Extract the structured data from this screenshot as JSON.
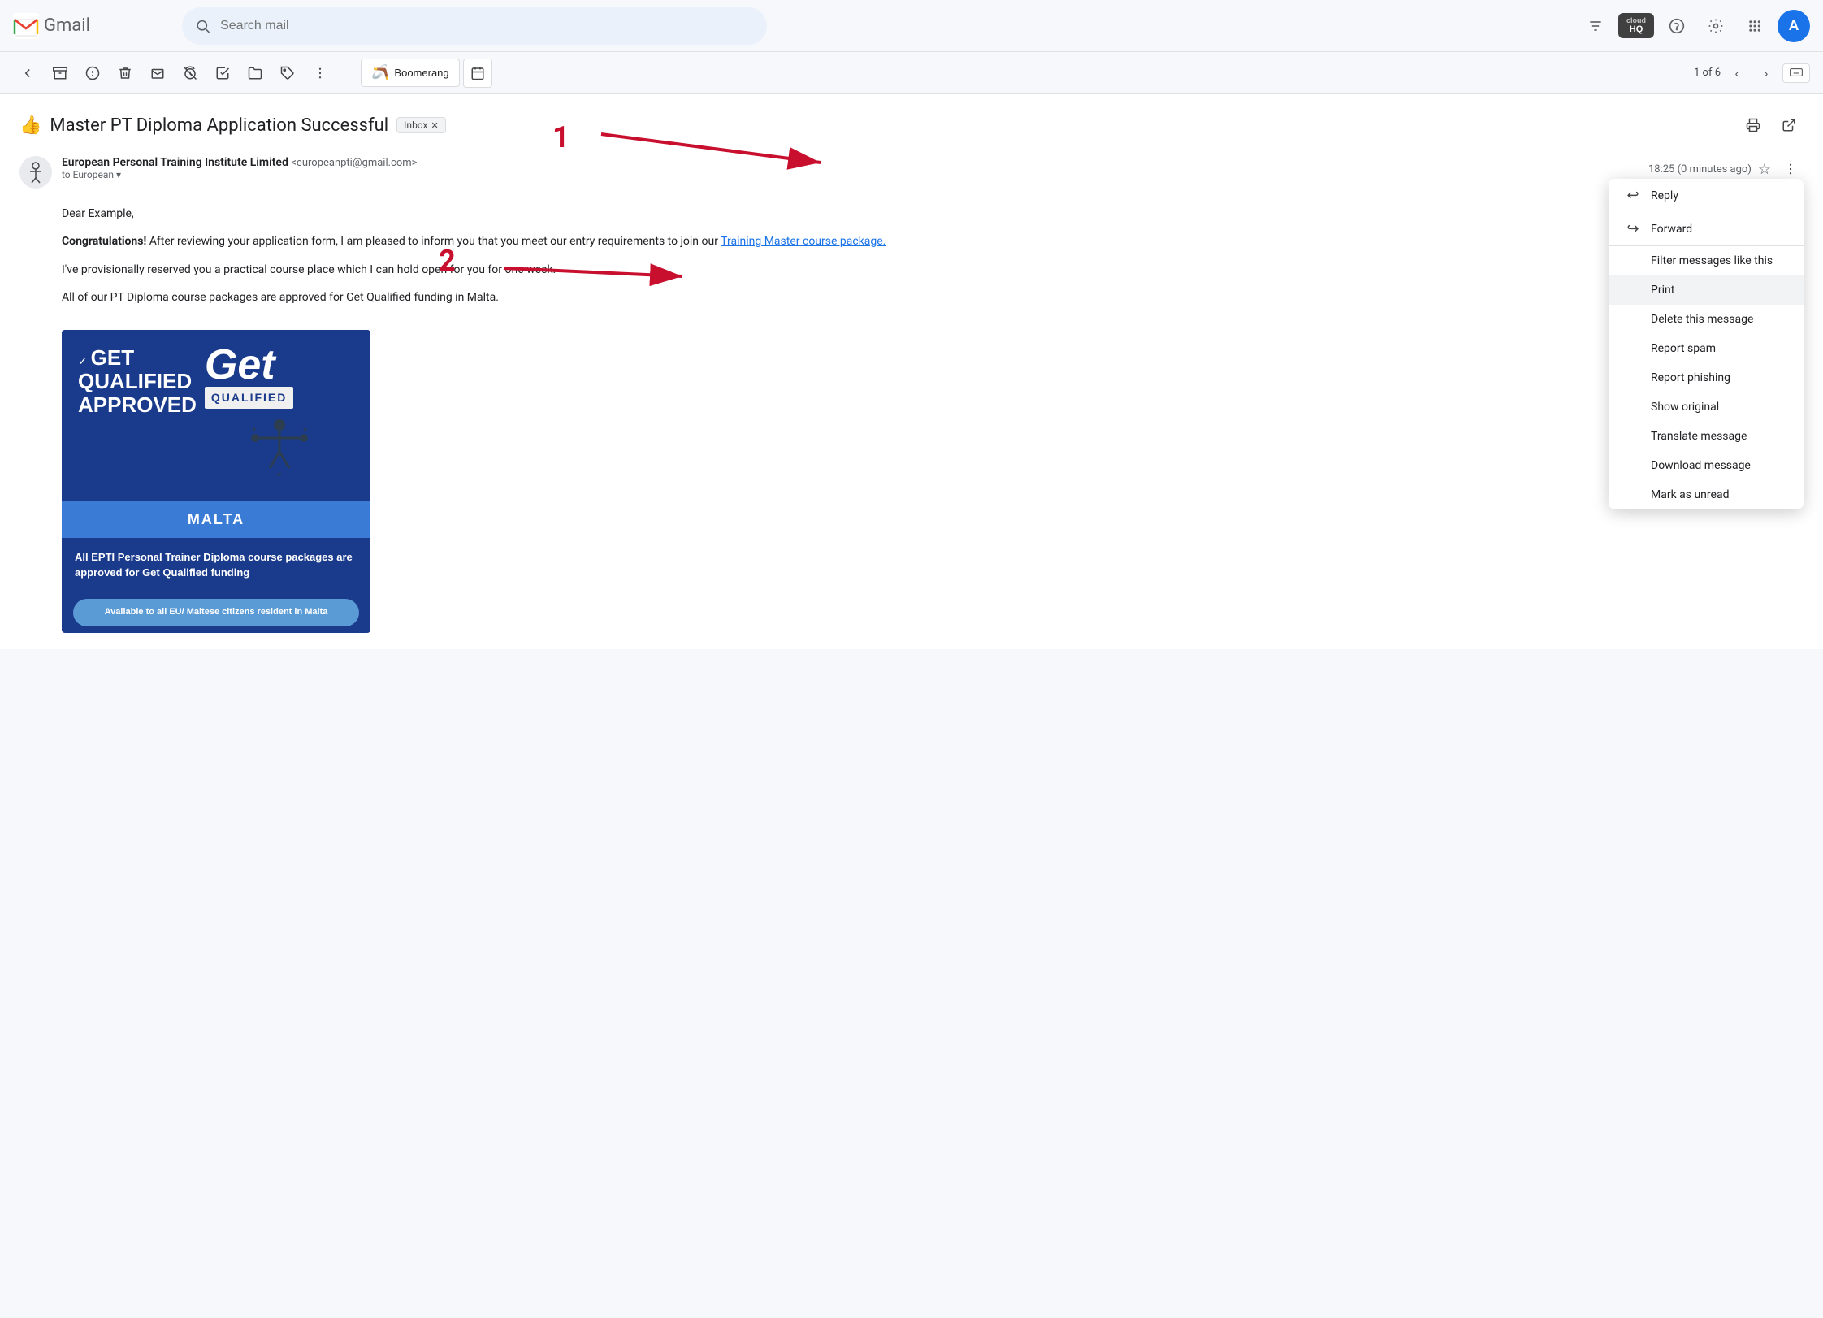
{
  "header": {
    "app_name": "Gmail",
    "search_placeholder": "Search mail"
  },
  "toolbar": {
    "pagination": "1 of 6",
    "back_label": "Back",
    "archive_label": "Archive",
    "report_spam_label": "Report spam",
    "delete_label": "Delete",
    "mark_unread_label": "Mark as unread",
    "snooze_label": "Snooze",
    "add_to_tasks_label": "Add to Tasks",
    "move_to_label": "Move to",
    "labels_label": "Labels",
    "more_label": "More",
    "boomerang_label": "Boomerang",
    "keyboard_label": "Keyboard shortcuts"
  },
  "email": {
    "subject": "Master PT Diploma Application Successful",
    "subject_emoji": "👍",
    "inbox_tag": "Inbox",
    "sender_name": "European Personal Training Institute Limited",
    "sender_email": "<europeanpti@gmail.com>",
    "sender_to": "to European",
    "timestamp": "18:25 (0 minutes ago)",
    "greeting": "Dear Example,",
    "body_bold": "Congratulations!",
    "body_text": " After reviewing your application form, I am pleased to inform you that you meet our entry requirements to join our ",
    "link_text": "Training Master course package.",
    "body_para2": "I've provisionally reserved you a practical course place which I can hold open for you for one week.",
    "body_para3": "All of our PT Diploma course packages are approved for Get Qualified funding in Malta."
  },
  "banner": {
    "check": "✓",
    "title_line1": "GET QUALIFIED",
    "title_line2": "APPROVED",
    "malta": "MALTA",
    "desc": "All EPTI Personal Trainer Diploma course packages are approved for Get Qualified funding",
    "footer": "Available to all EU/ Maltese citizens resident in Malta",
    "get_text": "Get",
    "qualified_text": "QUALIFIED"
  },
  "dropdown": {
    "items": [
      {
        "icon": "↩",
        "label": "Reply",
        "has_icon": true
      },
      {
        "icon": "↪",
        "label": "Forward",
        "has_icon": true
      },
      {
        "icon": "",
        "label": "Filter messages like this",
        "has_icon": false
      },
      {
        "icon": "",
        "label": "Print",
        "has_icon": false
      },
      {
        "icon": "",
        "label": "Delete this message",
        "has_icon": false
      },
      {
        "icon": "",
        "label": "Report spam",
        "has_icon": false
      },
      {
        "icon": "",
        "label": "Report phishing",
        "has_icon": false
      },
      {
        "icon": "",
        "label": "Show original",
        "has_icon": false
      },
      {
        "icon": "",
        "label": "Translate message",
        "has_icon": false
      },
      {
        "icon": "",
        "label": "Download message",
        "has_icon": false
      },
      {
        "icon": "",
        "label": "Mark as unread",
        "has_icon": false
      }
    ]
  },
  "annotations": {
    "number1": "1",
    "number2": "2"
  }
}
